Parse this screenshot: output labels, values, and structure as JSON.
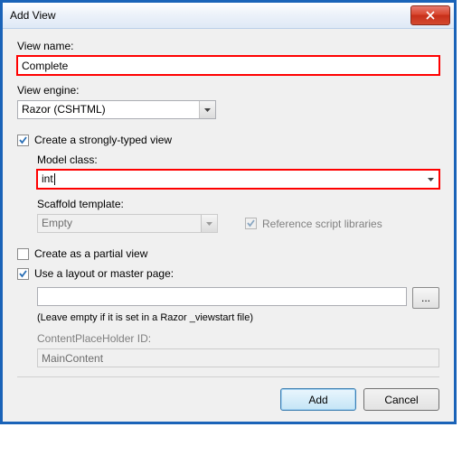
{
  "titlebar": {
    "title": "Add View"
  },
  "labels": {
    "viewName": "View name:",
    "viewEngine": "View engine:",
    "modelClass": "Model class:",
    "scaffoldTemplate": "Scaffold template:",
    "contentPlaceholder": "ContentPlaceHolder ID:"
  },
  "viewName": {
    "value": "Complete"
  },
  "viewEngine": {
    "selected": "Razor (CSHTML)"
  },
  "stronglyTyped": {
    "label": "Create a strongly-typed view",
    "checked": true
  },
  "modelClass": {
    "value": "int"
  },
  "scaffold": {
    "selected": "Empty"
  },
  "refScripts": {
    "label": "Reference script libraries",
    "checked": true
  },
  "partial": {
    "label": "Create as a partial view",
    "checked": false
  },
  "useLayout": {
    "label": "Use a layout or master page:",
    "checked": true
  },
  "layoutPath": {
    "value": ""
  },
  "layoutHint": "(Leave empty if it is set in a Razor _viewstart file)",
  "placeholderId": {
    "value": "MainContent"
  },
  "browseLabel": "...",
  "buttons": {
    "add": "Add",
    "cancel": "Cancel"
  }
}
